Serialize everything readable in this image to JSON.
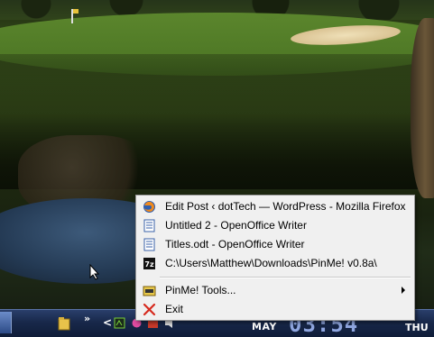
{
  "menu": {
    "items": [
      {
        "label": "Edit Post ‹ dotTech — WordPress - Mozilla Firefox",
        "icon": "firefox-icon"
      },
      {
        "label": "Untitled 2 - OpenOffice Writer",
        "icon": "openoffice-writer-icon"
      },
      {
        "label": "Titles.odt - OpenOffice Writer",
        "icon": "openoffice-writer-icon"
      },
      {
        "label": "C:\\Users\\Matthew\\Downloads\\PinMe! v0.8a\\",
        "icon": "7zip-icon"
      }
    ],
    "tools": {
      "label": "PinMe! Tools...",
      "icon": "pinme-tools-icon"
    },
    "exit": {
      "label": "Exit",
      "icon": "exit-x-icon"
    },
    "exit_color": "#d62a1e"
  },
  "taskbar": {
    "chevron": "»",
    "tray_expand": "<",
    "clock": {
      "month": "MAY",
      "time": "03:54",
      "weekday": "THU"
    },
    "clock_color": "#8fa6e0"
  }
}
